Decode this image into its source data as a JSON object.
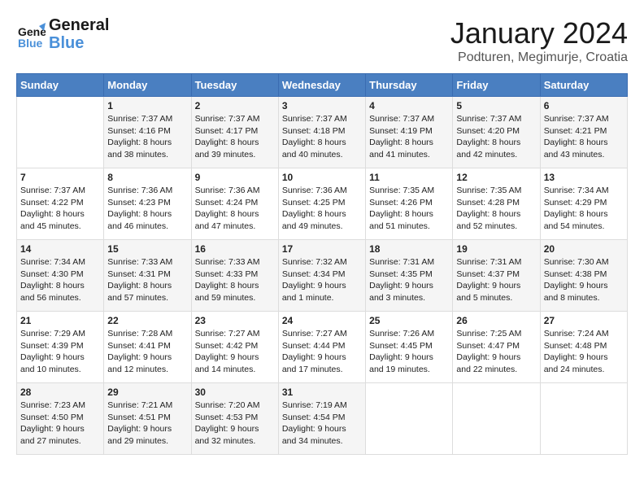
{
  "header": {
    "logo_line1": "General",
    "logo_line2": "Blue",
    "month_title": "January 2024",
    "location": "Podturen, Megimurje, Croatia"
  },
  "weekdays": [
    "Sunday",
    "Monday",
    "Tuesday",
    "Wednesday",
    "Thursday",
    "Friday",
    "Saturday"
  ],
  "weeks": [
    [
      {
        "day": "",
        "sunrise": "",
        "sunset": "",
        "daylight": ""
      },
      {
        "day": "1",
        "sunrise": "Sunrise: 7:37 AM",
        "sunset": "Sunset: 4:16 PM",
        "daylight": "Daylight: 8 hours and 38 minutes."
      },
      {
        "day": "2",
        "sunrise": "Sunrise: 7:37 AM",
        "sunset": "Sunset: 4:17 PM",
        "daylight": "Daylight: 8 hours and 39 minutes."
      },
      {
        "day": "3",
        "sunrise": "Sunrise: 7:37 AM",
        "sunset": "Sunset: 4:18 PM",
        "daylight": "Daylight: 8 hours and 40 minutes."
      },
      {
        "day": "4",
        "sunrise": "Sunrise: 7:37 AM",
        "sunset": "Sunset: 4:19 PM",
        "daylight": "Daylight: 8 hours and 41 minutes."
      },
      {
        "day": "5",
        "sunrise": "Sunrise: 7:37 AM",
        "sunset": "Sunset: 4:20 PM",
        "daylight": "Daylight: 8 hours and 42 minutes."
      },
      {
        "day": "6",
        "sunrise": "Sunrise: 7:37 AM",
        "sunset": "Sunset: 4:21 PM",
        "daylight": "Daylight: 8 hours and 43 minutes."
      }
    ],
    [
      {
        "day": "7",
        "sunrise": "Sunrise: 7:37 AM",
        "sunset": "Sunset: 4:22 PM",
        "daylight": "Daylight: 8 hours and 45 minutes."
      },
      {
        "day": "8",
        "sunrise": "Sunrise: 7:36 AM",
        "sunset": "Sunset: 4:23 PM",
        "daylight": "Daylight: 8 hours and 46 minutes."
      },
      {
        "day": "9",
        "sunrise": "Sunrise: 7:36 AM",
        "sunset": "Sunset: 4:24 PM",
        "daylight": "Daylight: 8 hours and 47 minutes."
      },
      {
        "day": "10",
        "sunrise": "Sunrise: 7:36 AM",
        "sunset": "Sunset: 4:25 PM",
        "daylight": "Daylight: 8 hours and 49 minutes."
      },
      {
        "day": "11",
        "sunrise": "Sunrise: 7:35 AM",
        "sunset": "Sunset: 4:26 PM",
        "daylight": "Daylight: 8 hours and 51 minutes."
      },
      {
        "day": "12",
        "sunrise": "Sunrise: 7:35 AM",
        "sunset": "Sunset: 4:28 PM",
        "daylight": "Daylight: 8 hours and 52 minutes."
      },
      {
        "day": "13",
        "sunrise": "Sunrise: 7:34 AM",
        "sunset": "Sunset: 4:29 PM",
        "daylight": "Daylight: 8 hours and 54 minutes."
      }
    ],
    [
      {
        "day": "14",
        "sunrise": "Sunrise: 7:34 AM",
        "sunset": "Sunset: 4:30 PM",
        "daylight": "Daylight: 8 hours and 56 minutes."
      },
      {
        "day": "15",
        "sunrise": "Sunrise: 7:33 AM",
        "sunset": "Sunset: 4:31 PM",
        "daylight": "Daylight: 8 hours and 57 minutes."
      },
      {
        "day": "16",
        "sunrise": "Sunrise: 7:33 AM",
        "sunset": "Sunset: 4:33 PM",
        "daylight": "Daylight: 8 hours and 59 minutes."
      },
      {
        "day": "17",
        "sunrise": "Sunrise: 7:32 AM",
        "sunset": "Sunset: 4:34 PM",
        "daylight": "Daylight: 9 hours and 1 minute."
      },
      {
        "day": "18",
        "sunrise": "Sunrise: 7:31 AM",
        "sunset": "Sunset: 4:35 PM",
        "daylight": "Daylight: 9 hours and 3 minutes."
      },
      {
        "day": "19",
        "sunrise": "Sunrise: 7:31 AM",
        "sunset": "Sunset: 4:37 PM",
        "daylight": "Daylight: 9 hours and 5 minutes."
      },
      {
        "day": "20",
        "sunrise": "Sunrise: 7:30 AM",
        "sunset": "Sunset: 4:38 PM",
        "daylight": "Daylight: 9 hours and 8 minutes."
      }
    ],
    [
      {
        "day": "21",
        "sunrise": "Sunrise: 7:29 AM",
        "sunset": "Sunset: 4:39 PM",
        "daylight": "Daylight: 9 hours and 10 minutes."
      },
      {
        "day": "22",
        "sunrise": "Sunrise: 7:28 AM",
        "sunset": "Sunset: 4:41 PM",
        "daylight": "Daylight: 9 hours and 12 minutes."
      },
      {
        "day": "23",
        "sunrise": "Sunrise: 7:27 AM",
        "sunset": "Sunset: 4:42 PM",
        "daylight": "Daylight: 9 hours and 14 minutes."
      },
      {
        "day": "24",
        "sunrise": "Sunrise: 7:27 AM",
        "sunset": "Sunset: 4:44 PM",
        "daylight": "Daylight: 9 hours and 17 minutes."
      },
      {
        "day": "25",
        "sunrise": "Sunrise: 7:26 AM",
        "sunset": "Sunset: 4:45 PM",
        "daylight": "Daylight: 9 hours and 19 minutes."
      },
      {
        "day": "26",
        "sunrise": "Sunrise: 7:25 AM",
        "sunset": "Sunset: 4:47 PM",
        "daylight": "Daylight: 9 hours and 22 minutes."
      },
      {
        "day": "27",
        "sunrise": "Sunrise: 7:24 AM",
        "sunset": "Sunset: 4:48 PM",
        "daylight": "Daylight: 9 hours and 24 minutes."
      }
    ],
    [
      {
        "day": "28",
        "sunrise": "Sunrise: 7:23 AM",
        "sunset": "Sunset: 4:50 PM",
        "daylight": "Daylight: 9 hours and 27 minutes."
      },
      {
        "day": "29",
        "sunrise": "Sunrise: 7:21 AM",
        "sunset": "Sunset: 4:51 PM",
        "daylight": "Daylight: 9 hours and 29 minutes."
      },
      {
        "day": "30",
        "sunrise": "Sunrise: 7:20 AM",
        "sunset": "Sunset: 4:53 PM",
        "daylight": "Daylight: 9 hours and 32 minutes."
      },
      {
        "day": "31",
        "sunrise": "Sunrise: 7:19 AM",
        "sunset": "Sunset: 4:54 PM",
        "daylight": "Daylight: 9 hours and 34 minutes."
      },
      {
        "day": "",
        "sunrise": "",
        "sunset": "",
        "daylight": ""
      },
      {
        "day": "",
        "sunrise": "",
        "sunset": "",
        "daylight": ""
      },
      {
        "day": "",
        "sunrise": "",
        "sunset": "",
        "daylight": ""
      }
    ]
  ]
}
